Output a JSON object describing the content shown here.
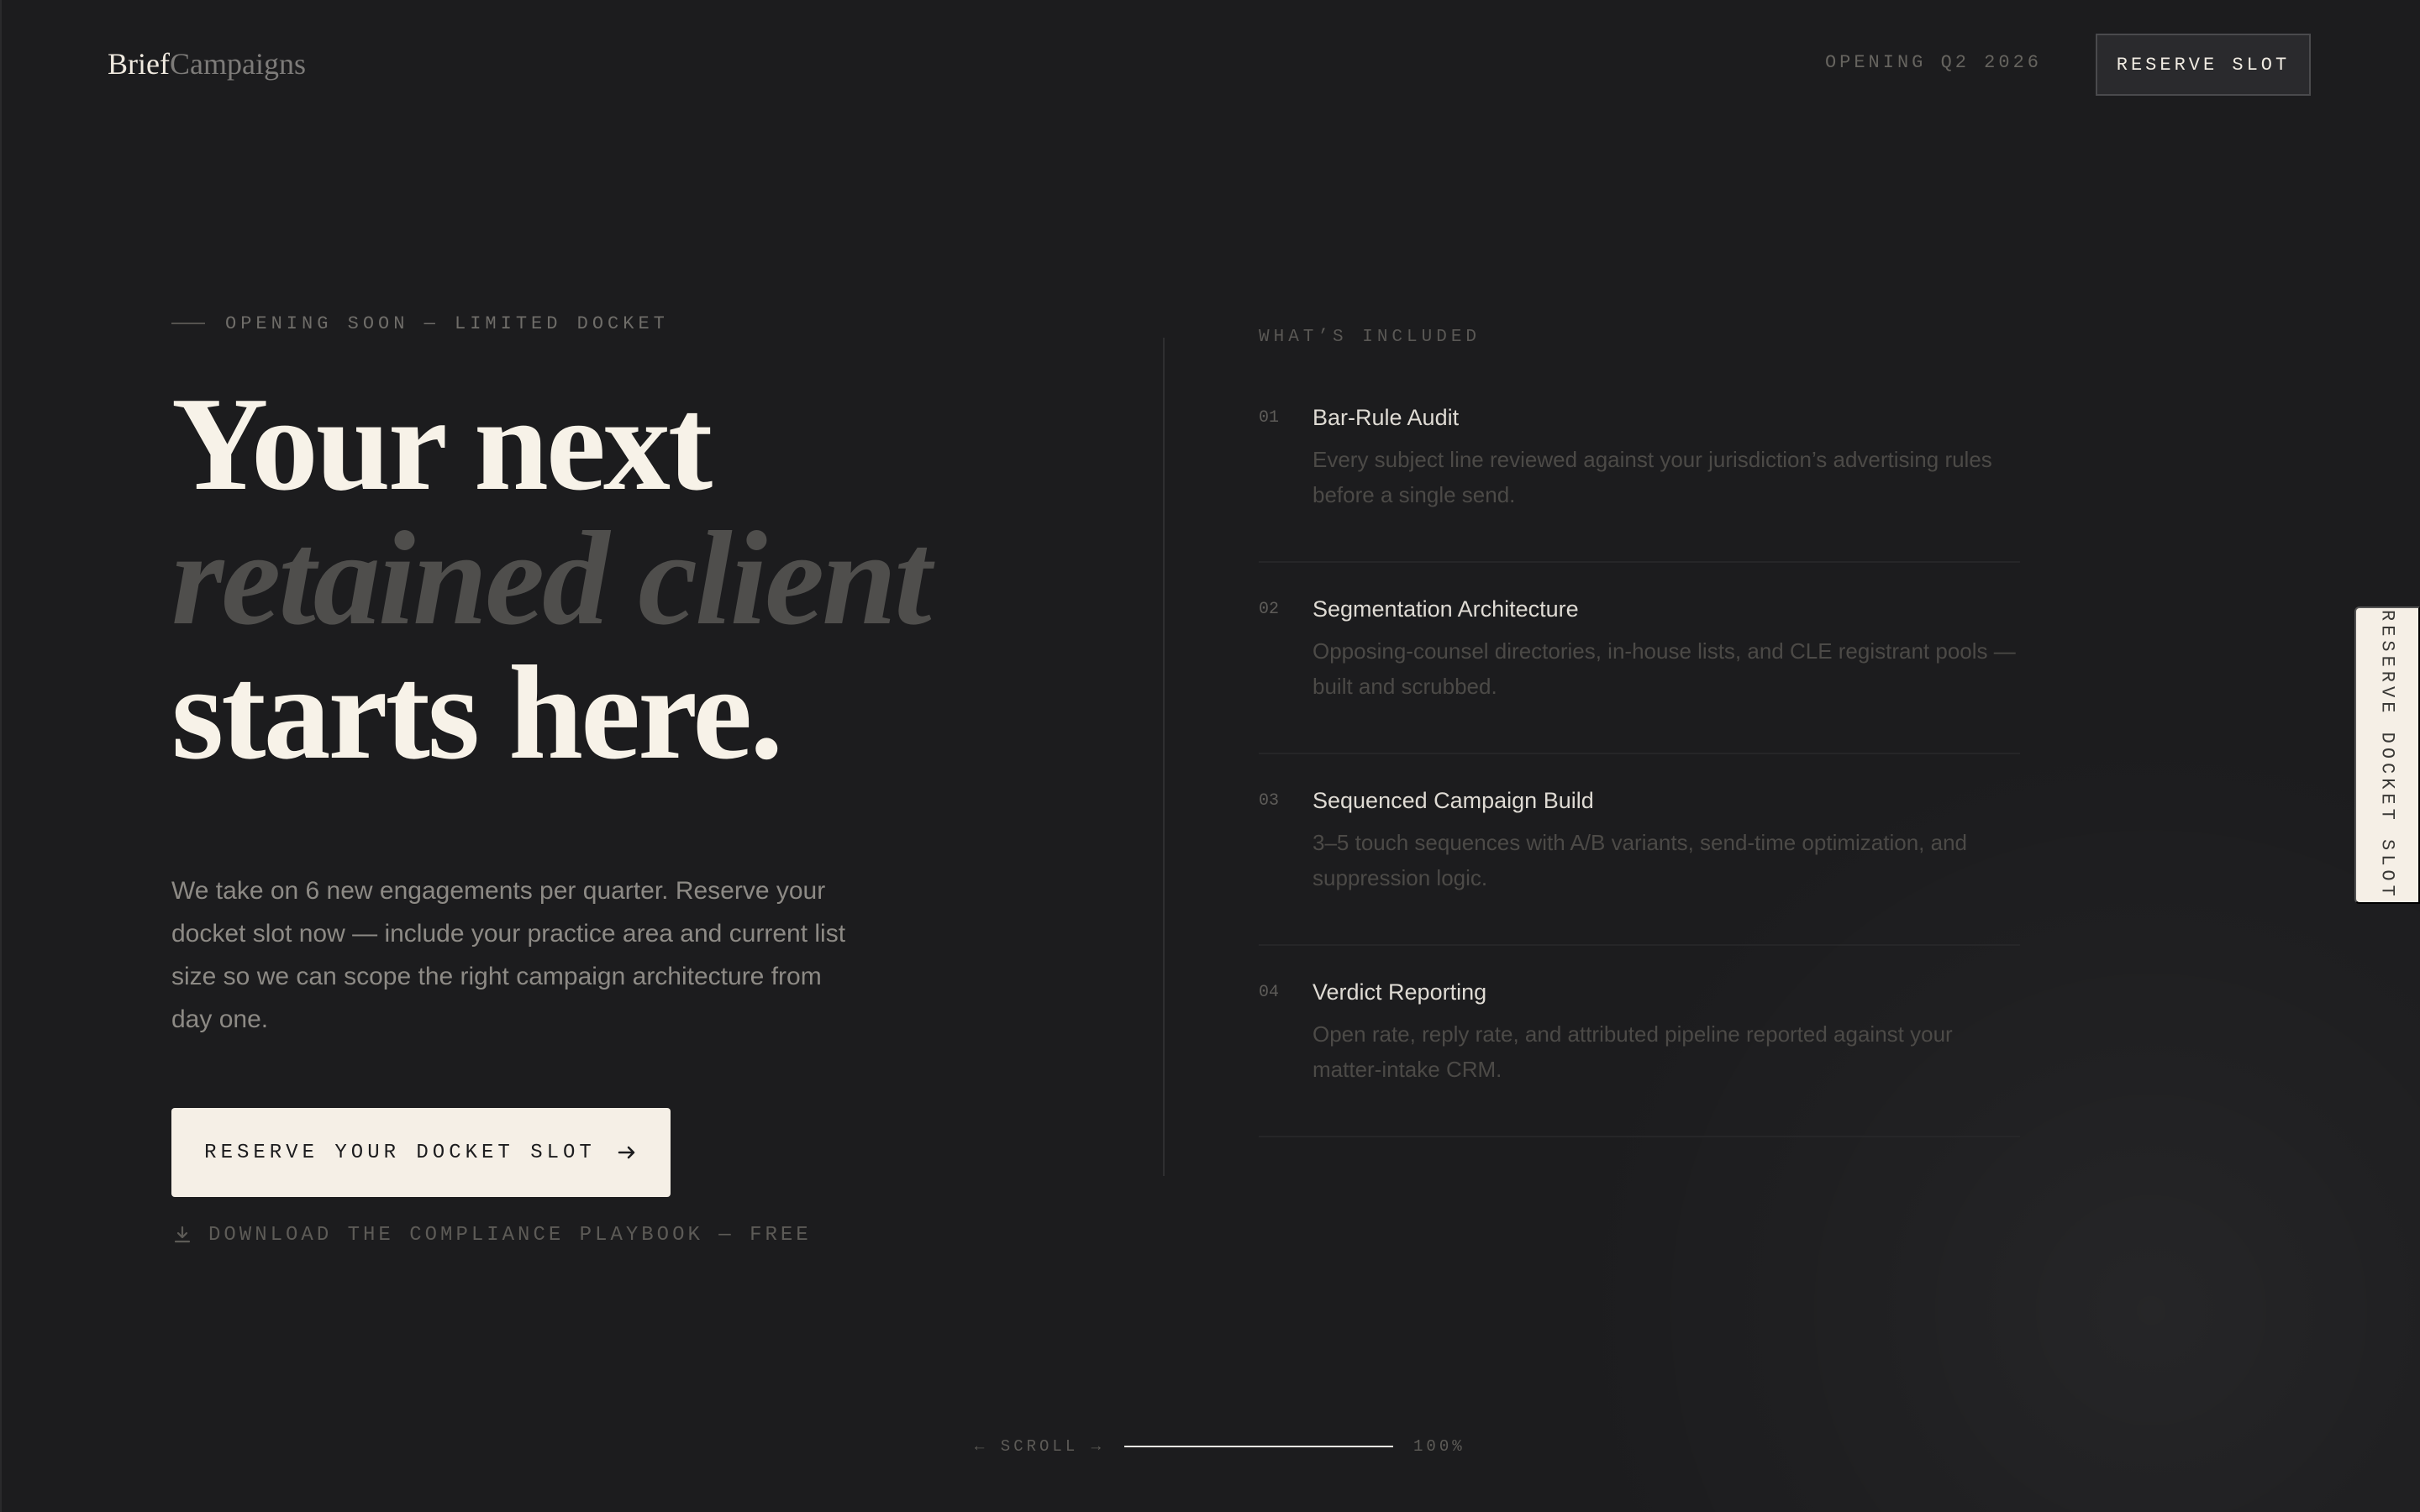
{
  "header": {
    "logo_main": "Brief",
    "logo_sub": "Campaigns",
    "opening": "OPENING Q2 2026",
    "reserve_slot": "RESERVE SLOT"
  },
  "hero": {
    "eyebrow": "OPENING SOON — LIMITED DOCKET",
    "headline_line1": "Your next",
    "headline_line2": "retained client",
    "headline_line3": "starts here.",
    "intro": "We take on 6 new engagements per quarter. Reserve your docket slot now — include your practice area and current list size so we can scope the right campaign architecture from day one.",
    "cta": "RESERVE YOUR DOCKET SLOT",
    "download": "DOWNLOAD THE COMPLIANCE PLAYBOOK — FREE"
  },
  "included": {
    "label": "WHAT’S INCLUDED",
    "items": [
      {
        "number": "01",
        "title": "Bar-Rule Audit",
        "description": "Every subject line reviewed against your jurisdiction’s advertising rules before a single send."
      },
      {
        "number": "02",
        "title": "Segmentation Architecture",
        "description": "Opposing-counsel directories, in-house lists, and CLE registrant pools — built and scrubbed."
      },
      {
        "number": "03",
        "title": "Sequenced Campaign Build",
        "description": "3–5 touch sequences with A/B variants, send-time optimization, and suppression logic."
      },
      {
        "number": "04",
        "title": "Verdict Reporting",
        "description": "Open rate, reply rate, and attributed pipeline reported against your matter-intake CRM."
      }
    ]
  },
  "side_tab": {
    "label": "RESERVE DOCKET SLOT"
  },
  "scroll": {
    "label": "← SCROLL →",
    "percent": "100%",
    "progress": 1
  },
  "icons": {
    "arrow": "arrow-right-icon",
    "download": "download-icon"
  },
  "colors": {
    "background": "#1c1c1e",
    "cream": "#f5efe6",
    "muted": "#5d5b57"
  }
}
